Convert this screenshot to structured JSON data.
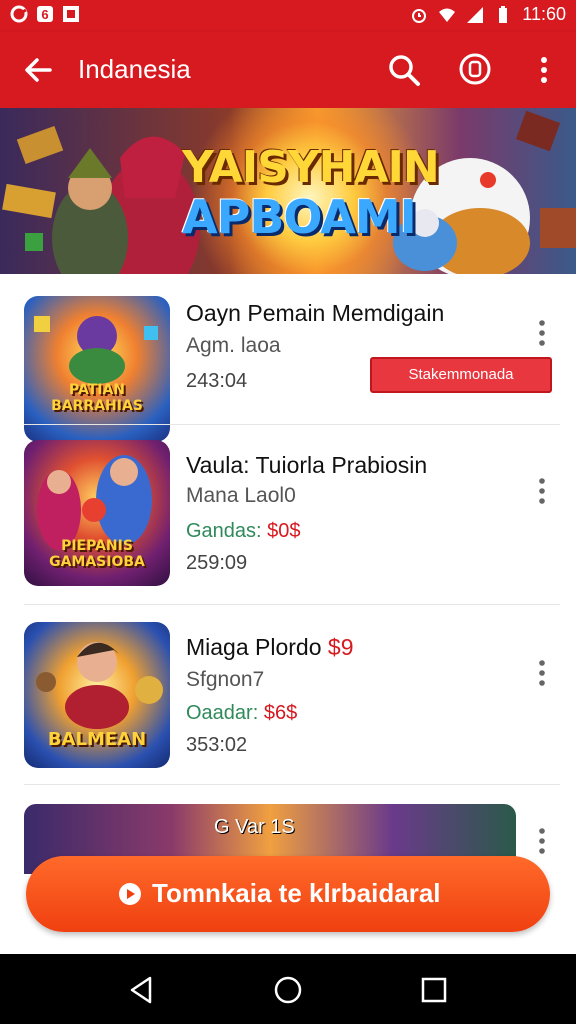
{
  "status_bar": {
    "time": "11:60"
  },
  "app_bar": {
    "title": "Indanesia"
  },
  "banner": {
    "line1": "YAISYHAIN",
    "line2": "APBOAMI"
  },
  "items": [
    {
      "title": "Oayn Pemain Memdigain",
      "subtitle": "Agm. laoa",
      "time": "243:04",
      "tag": "Stakemmonada",
      "thumb_text": "PATIAN BARRAHIAS"
    },
    {
      "title": "Vaula: Tuiorla Prabiosin",
      "subtitle": "Mana Laol0",
      "price_label": "Gandas:",
      "price_value": "$0$",
      "time": "259:09",
      "thumb_text": "PIEPANIS GAMASIOBA"
    },
    {
      "title": "Miaga Plordo",
      "title_price": "$9",
      "subtitle": "Sfgnon7",
      "price_label": "Oaadar:",
      "price_value": "$6$",
      "time": "353:02",
      "thumb_text": "BALMEAN"
    },
    {
      "banner_text": "G Var 1S"
    }
  ],
  "cta": {
    "label": "Tomnkaia te klrbaidaral"
  },
  "colors": {
    "primary": "#d71920",
    "cta": "#f04010",
    "price_green": "#2f8a5a"
  }
}
